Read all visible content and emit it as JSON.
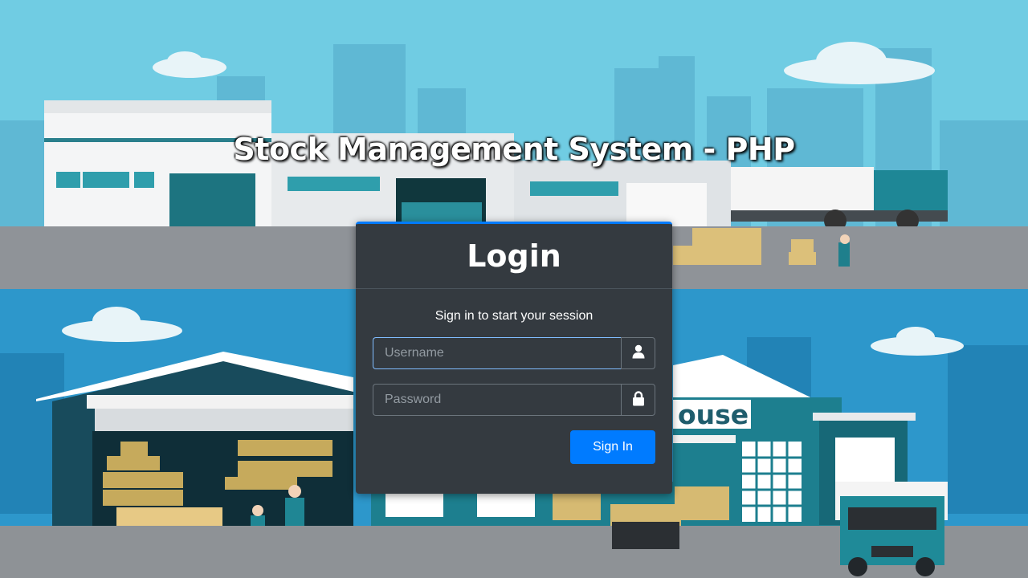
{
  "header": {
    "app_title": "Stock Management System - PHP"
  },
  "login": {
    "title": "Login",
    "subtitle": "Sign in to start your session",
    "username": {
      "placeholder": "Username",
      "value": "",
      "icon": "user-icon"
    },
    "password": {
      "placeholder": "Password",
      "value": "",
      "icon": "lock-icon"
    },
    "submit_label": "Sign In"
  },
  "background": {
    "sign_text": "ouse"
  },
  "colors": {
    "accent": "#007bff",
    "card": "#343a40",
    "sky_top": "#6ccbe3",
    "sky_bottom": "#2b97cc",
    "road": "#8e9296"
  }
}
